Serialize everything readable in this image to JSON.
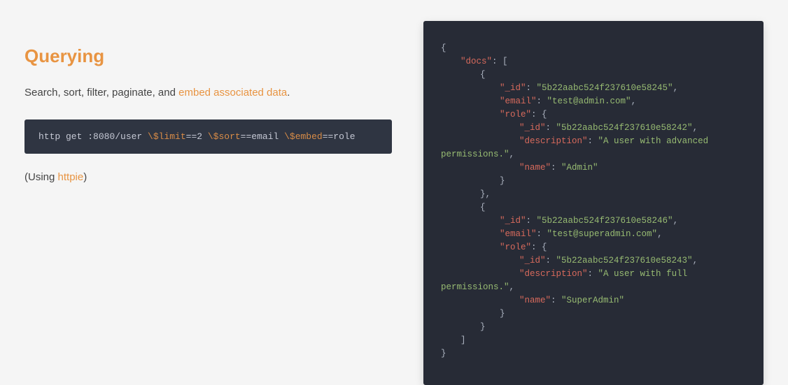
{
  "heading": "Querying",
  "description": {
    "prefix": "Search, sort, filter, paginate, and ",
    "link": "embed associated data",
    "suffix": "."
  },
  "command": {
    "parts": [
      {
        "t": "plain",
        "v": "http get :8080/user "
      },
      {
        "t": "param",
        "v": "\\$limit"
      },
      {
        "t": "plain",
        "v": "==2 "
      },
      {
        "t": "param",
        "v": "\\$sort"
      },
      {
        "t": "plain",
        "v": "==email "
      },
      {
        "t": "param",
        "v": "\\$embed"
      },
      {
        "t": "plain",
        "v": "==role"
      }
    ]
  },
  "note": {
    "prefix": "(Using ",
    "link": "httpie",
    "suffix": ")"
  },
  "json_lines": [
    {
      "ind": 0,
      "tokens": [
        {
          "t": "pun",
          "v": "{"
        }
      ]
    },
    {
      "ind": 1,
      "tokens": [
        {
          "t": "key",
          "v": "\"docs\""
        },
        {
          "t": "pun",
          "v": ": ["
        }
      ]
    },
    {
      "ind": 2,
      "tokens": [
        {
          "t": "pun",
          "v": "{"
        }
      ]
    },
    {
      "ind": 3,
      "tokens": [
        {
          "t": "key",
          "v": "\"_id\""
        },
        {
          "t": "pun",
          "v": ": "
        },
        {
          "t": "str",
          "v": "\"5b22aabc524f237610e58245\""
        },
        {
          "t": "pun",
          "v": ","
        }
      ]
    },
    {
      "ind": 3,
      "tokens": [
        {
          "t": "key",
          "v": "\"email\""
        },
        {
          "t": "pun",
          "v": ": "
        },
        {
          "t": "str",
          "v": "\"test@admin.com\""
        },
        {
          "t": "pun",
          "v": ","
        }
      ]
    },
    {
      "ind": 3,
      "tokens": [
        {
          "t": "key",
          "v": "\"role\""
        },
        {
          "t": "pun",
          "v": ": {"
        }
      ]
    },
    {
      "ind": 4,
      "tokens": [
        {
          "t": "key",
          "v": "\"_id\""
        },
        {
          "t": "pun",
          "v": ": "
        },
        {
          "t": "str",
          "v": "\"5b22aabc524f237610e58242\""
        },
        {
          "t": "pun",
          "v": ","
        }
      ]
    },
    {
      "ind": 4,
      "tokens": [
        {
          "t": "key",
          "v": "\"description\""
        },
        {
          "t": "pun",
          "v": ": "
        },
        {
          "t": "str",
          "v": "\"A user with advanced permissions.\""
        },
        {
          "t": "pun",
          "v": ","
        }
      ]
    },
    {
      "ind": 4,
      "tokens": [
        {
          "t": "key",
          "v": "\"name\""
        },
        {
          "t": "pun",
          "v": ": "
        },
        {
          "t": "str",
          "v": "\"Admin\""
        }
      ]
    },
    {
      "ind": 3,
      "tokens": [
        {
          "t": "pun",
          "v": "}"
        }
      ]
    },
    {
      "ind": 2,
      "tokens": [
        {
          "t": "pun",
          "v": "},"
        }
      ]
    },
    {
      "ind": 2,
      "tokens": [
        {
          "t": "pun",
          "v": "{"
        }
      ]
    },
    {
      "ind": 3,
      "tokens": [
        {
          "t": "key",
          "v": "\"_id\""
        },
        {
          "t": "pun",
          "v": ": "
        },
        {
          "t": "str",
          "v": "\"5b22aabc524f237610e58246\""
        },
        {
          "t": "pun",
          "v": ","
        }
      ]
    },
    {
      "ind": 3,
      "tokens": [
        {
          "t": "key",
          "v": "\"email\""
        },
        {
          "t": "pun",
          "v": ": "
        },
        {
          "t": "str",
          "v": "\"test@superadmin.com\""
        },
        {
          "t": "pun",
          "v": ","
        }
      ]
    },
    {
      "ind": 3,
      "tokens": [
        {
          "t": "key",
          "v": "\"role\""
        },
        {
          "t": "pun",
          "v": ": {"
        }
      ]
    },
    {
      "ind": 4,
      "tokens": [
        {
          "t": "key",
          "v": "\"_id\""
        },
        {
          "t": "pun",
          "v": ": "
        },
        {
          "t": "str",
          "v": "\"5b22aabc524f237610e58243\""
        },
        {
          "t": "pun",
          "v": ","
        }
      ]
    },
    {
      "ind": 4,
      "tokens": [
        {
          "t": "key",
          "v": "\"description\""
        },
        {
          "t": "pun",
          "v": ": "
        },
        {
          "t": "str",
          "v": "\"A user with full permissions.\""
        },
        {
          "t": "pun",
          "v": ","
        }
      ]
    },
    {
      "ind": 4,
      "tokens": [
        {
          "t": "key",
          "v": "\"name\""
        },
        {
          "t": "pun",
          "v": ": "
        },
        {
          "t": "str",
          "v": "\"SuperAdmin\""
        }
      ]
    },
    {
      "ind": 3,
      "tokens": [
        {
          "t": "pun",
          "v": "}"
        }
      ]
    },
    {
      "ind": 2,
      "tokens": [
        {
          "t": "pun",
          "v": "}"
        }
      ]
    },
    {
      "ind": 1,
      "tokens": [
        {
          "t": "pun",
          "v": "]"
        }
      ]
    },
    {
      "ind": 0,
      "tokens": [
        {
          "t": "pun",
          "v": "}"
        }
      ]
    }
  ]
}
